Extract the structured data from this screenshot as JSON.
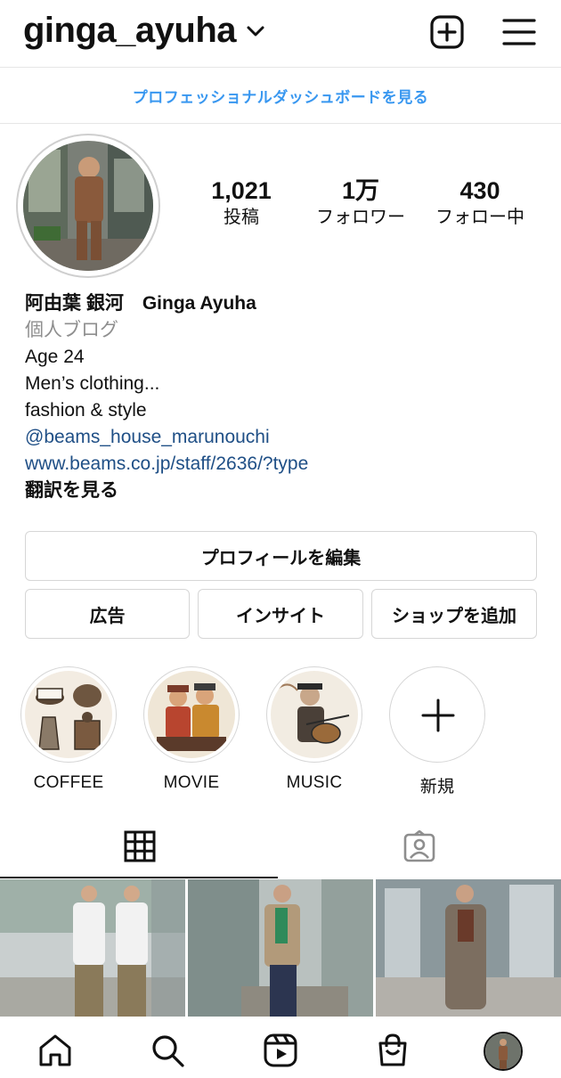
{
  "header": {
    "username": "ginga_ayuha"
  },
  "dashboard": {
    "label": "プロフェッショナルダッシュボードを見る",
    "color": "#3897f0"
  },
  "stats": [
    {
      "value": "1,021",
      "label": "投稿"
    },
    {
      "value": "1万",
      "label": "フォロワー"
    },
    {
      "value": "430",
      "label": "フォロー中"
    }
  ],
  "bio": {
    "name": "阿由葉 銀河　Ginga Ayuha",
    "category": "個人ブログ",
    "lines": [
      "Age 24",
      "Men’s clothing...",
      "fashion & style"
    ],
    "mention": "@beams_house_marunouchi",
    "url": "www.beams.co.jp/staff/2636/?type",
    "translate": "翻訳を見る"
  },
  "buttons": {
    "edit_profile": "プロフィールを編集",
    "ads": "広告",
    "insights": "インサイト",
    "add_shop": "ショップを追加"
  },
  "highlights": [
    {
      "label": "COFFEE"
    },
    {
      "label": "MOVIE"
    },
    {
      "label": "MUSIC"
    },
    {
      "label": "新規"
    }
  ],
  "tabs": {
    "grid_icon": "grid-icon",
    "tagged_icon": "tagged-person-icon"
  },
  "posts_count_visible": 3,
  "bottom_nav": [
    "home-icon",
    "search-icon",
    "reels-icon",
    "shop-icon",
    "profile-avatar"
  ]
}
